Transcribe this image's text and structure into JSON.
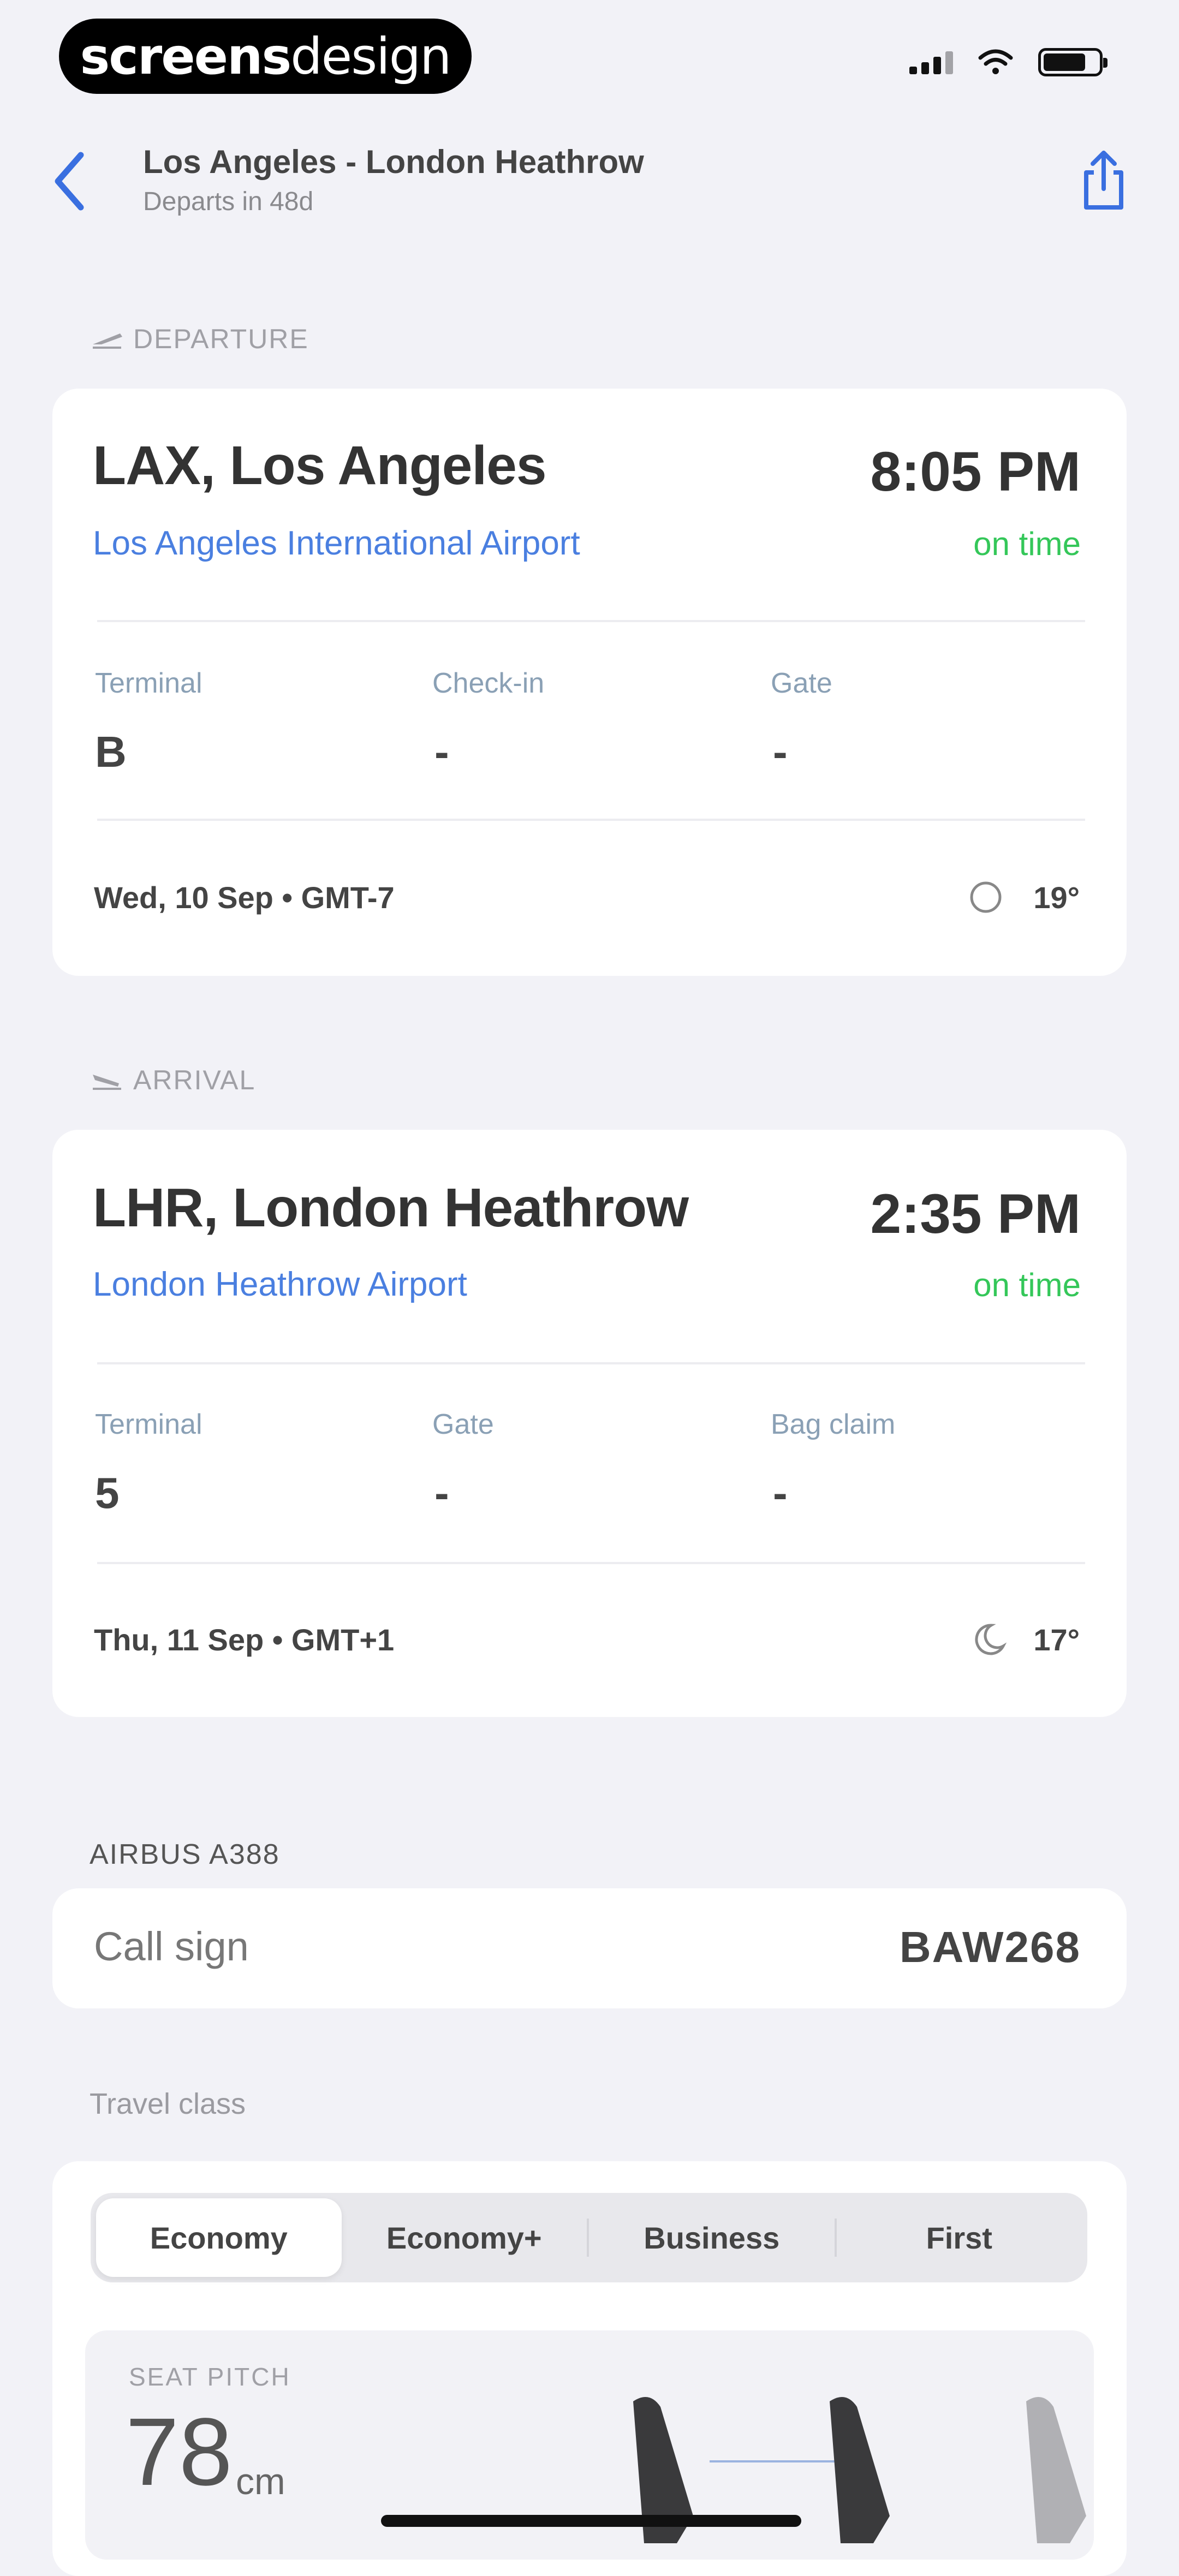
{
  "status_bar": {
    "brand_bold": "screens",
    "brand_light": "design"
  },
  "nav": {
    "title": "Los Angeles - London Heathrow",
    "subtitle": "Departs in 48d"
  },
  "departure": {
    "section_label": "DEPARTURE",
    "airport_code_city": "LAX, Los Angeles",
    "time": "8:05 PM",
    "airport_name": "Los Angeles International Airport",
    "status": "on time",
    "fields": [
      {
        "label": "Terminal",
        "value": "B"
      },
      {
        "label": "Check-in",
        "value": "-"
      },
      {
        "label": "Gate",
        "value": "-"
      }
    ],
    "date": "Wed, 10 Sep • GMT-7",
    "temperature": "19°",
    "weather_icon": "clear-night-icon"
  },
  "arrival": {
    "section_label": "ARRIVAL",
    "airport_code_city": "LHR, London Heathrow",
    "time": "2:35 PM",
    "airport_name": "London Heathrow Airport",
    "status": "on time",
    "fields": [
      {
        "label": "Terminal",
        "value": "5"
      },
      {
        "label": "Gate",
        "value": "-"
      },
      {
        "label": "Bag claim",
        "value": "-"
      }
    ],
    "date": "Thu, 11 Sep • GMT+1",
    "temperature": "17°",
    "weather_icon": "moon-icon"
  },
  "aircraft": {
    "model": "AIRBUS A388",
    "call_sign_label": "Call sign",
    "call_sign_value": "BAW268"
  },
  "travel_class": {
    "label": "Travel class",
    "options": [
      "Economy",
      "Economy+",
      "Business",
      "First"
    ],
    "selected": "Economy"
  },
  "seat_pitch": {
    "label": "SEAT PITCH",
    "value": "78",
    "unit": "cm"
  },
  "colors": {
    "accent": "#4a7fe0",
    "on_time": "#34c759",
    "background": "#f2f2f7"
  }
}
